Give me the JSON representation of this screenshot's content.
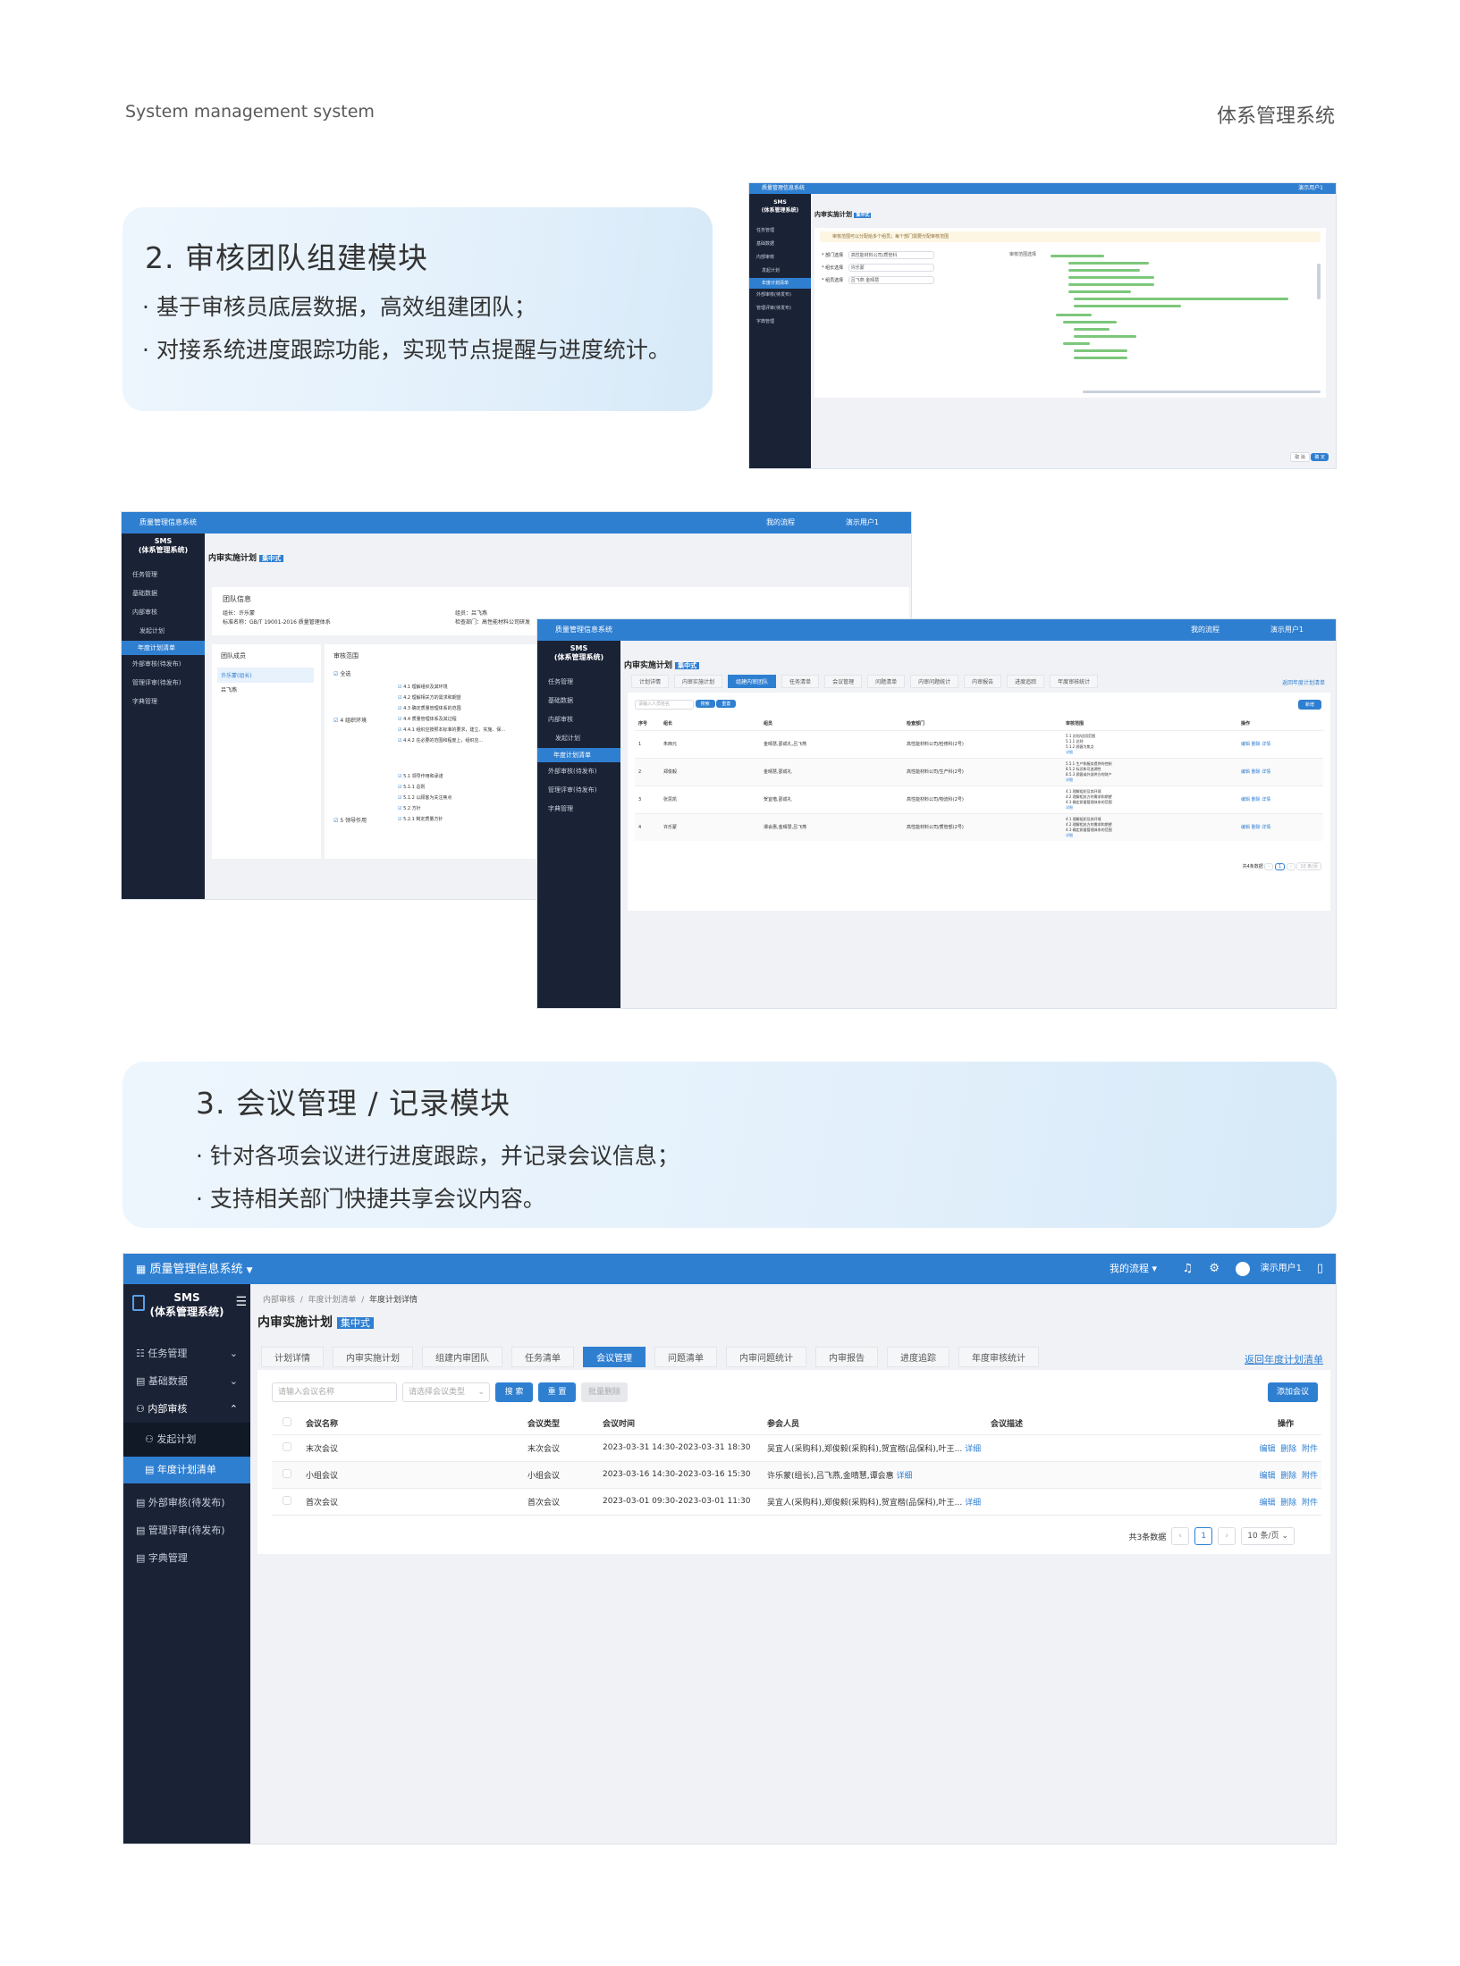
{
  "header": {
    "left": "System management system",
    "right": "体系管理系统"
  },
  "section2": {
    "title": "2. 审核团队组建模块",
    "bullets": [
      "· 基于审核员底层数据，高效组建团队；",
      "· 对接系统进度跟踪功能，实现节点提醒与进度统计。"
    ]
  },
  "section3": {
    "title": "3. 会议管理 / 记录模块",
    "bullets": [
      "· 针对各项会议进行进度跟踪，并记录会议信息；",
      "· 支持相关部门快捷共享会议内容。"
    ]
  },
  "app": {
    "system_name": "质量管理信息系统",
    "brand_line1": "SMS",
    "brand_line2": "(体系管理系统)",
    "my_process": "我的流程",
    "user": "演示用户1",
    "breadcrumb": [
      "内部审核",
      "年度计划清单",
      "年度计划详情"
    ],
    "page_title": "内审实施计划",
    "mode_badge": "集中式",
    "back_link": "返回年度计划清单",
    "side_items": [
      {
        "label": "任务管理",
        "icon": "list-icon",
        "arrow": "⌄"
      },
      {
        "label": "基础数据",
        "icon": "grid-icon",
        "arrow": "⌄"
      },
      {
        "label": "内部审核",
        "icon": "audit-icon",
        "arrow": "⌃"
      }
    ],
    "side_subs": [
      {
        "label": "发起计划",
        "icon": "plan-icon"
      },
      {
        "label": "年度计划清单",
        "icon": "doc-icon"
      }
    ],
    "side_more": [
      "外部审核(待发布)",
      "管理评审(待发布)",
      "字典管理"
    ],
    "tabs": [
      "计划详情",
      "内审实施计划",
      "组建内审团队",
      "任务清单",
      "会议管理",
      "问题清单",
      "内审问题统计",
      "内审报告",
      "进度追踪",
      "年度审核统计"
    ],
    "meeting": {
      "search_placeholder": "请输入会议名称",
      "type_placeholder": "请选择会议类型",
      "btn_search": "搜 索",
      "btn_reset": "重 置",
      "btn_batch_delete": "批量删除",
      "btn_add": "添加会议",
      "columns": [
        "会议名称",
        "会议类型",
        "会议时间",
        "参会人员",
        "会议描述",
        "操作"
      ],
      "rows": [
        {
          "name": "末次会议",
          "type": "末次会议",
          "time": "2023-03-31 14:30-2023-03-31 18:30",
          "people": "吴宜人(采购科),郑俊毅(采购科),贺宜楷(品保科),叶王...",
          "detail": "详细"
        },
        {
          "name": "小组会议",
          "type": "小组会议",
          "time": "2023-03-16 14:30-2023-03-16 15:30",
          "people": "许乐蒙(组长),吕飞燕,金晴慧,谭会惠",
          "detail": "详细"
        },
        {
          "name": "首次会议",
          "type": "首次会议",
          "time": "2023-03-01 09:30-2023-03-01 11:30",
          "people": "吴宜人(采购科),郑俊毅(采购科),贺宜楷(品保科),叶王...",
          "detail": "详细"
        }
      ],
      "ops": [
        "编辑",
        "删除",
        "附件"
      ],
      "total": "共3条数据",
      "page": "1",
      "page_size": "10 条/页"
    },
    "team": {
      "section_title": "团队信息",
      "leader_label": "组长：许乐蒙",
      "standard_label": "标准名称：GB/T 19001-2016 质量管理体系",
      "member_label": "组员：吕飞燕",
      "dept_label": "检查部门：高性能材料公司研发",
      "members_title": "团队成员",
      "scope_title": "审核范围",
      "members": [
        "许乐蒙(组长)",
        "吕飞燕"
      ],
      "scope_all": "全选",
      "scope_group1": "4 组织环境",
      "scope_group2": "5 领导作用",
      "scope_items1": [
        "4.1 理解组织及其环境",
        "4.2 理解相关方的需求和期望",
        "4.3 确定质量管理体系的范围",
        "4.4 质量管理体系及其过程",
        "4.4.1 组织应按照本标准的要求，建立、实施、保...",
        "4.4.2 在必要的范围和程度上，组织应..."
      ],
      "scope_items2": [
        "5.1 领导作用和承诺",
        "5.1.1 总则",
        "5.1.2 以顾客为关注焦点",
        "5.2 方针",
        "5.2.1 制定质量方针"
      ]
    },
    "team_list": {
      "search_placeholder": "请输入人员姓名",
      "btn_search": "搜索",
      "btn_reset": "重置",
      "btn_add": "新增",
      "columns": [
        "序号",
        "组长",
        "组员",
        "检查部门",
        "审核范围",
        "操作"
      ],
      "rows": [
        {
          "no": "1",
          "leader": "朱西元",
          "members": "金晴慧,邵成礼,吕飞燕",
          "dept": "高性能材料公司/检修科(2号)",
          "scope": [
            "5.1 总则/适用范围",
            "5.1.1 总则",
            "5.1.2 顾客为焦点",
            "详细"
          ]
        },
        {
          "no": "2",
          "leader": "郑俊毅",
          "members": "金晴慧,邵成礼",
          "dept": "高性能材料公司/生产科(2号)",
          "scope": [
            "5.5.1 生产和服务提供的控制",
            "8.5.2 标识和可追溯性",
            "8.5.3 顾客或外部供方的财产",
            "详细"
          ]
        },
        {
          "no": "3",
          "leader": "张思凯",
          "members": "贺宜楷,邵成礼",
          "dept": "高性能材料公司/物流科(2号)",
          "scope": [
            "4.1 理解组织及其环境",
            "4.2 理解相关方的需求和期望",
            "4.3 确定质量管理体系的范围",
            "详细"
          ]
        },
        {
          "no": "4",
          "leader": "许乐蒙",
          "members": "谭会惠,金晴慧,吕飞燕",
          "dept": "高性能材料公司/质管部(2号)",
          "scope": [
            "4.1 理解组织及其环境",
            "4.2 理解相关方的需求和期望",
            "4.3 确定质量管理体系的范围",
            "详细"
          ]
        }
      ],
      "ops": [
        "编辑",
        "删除",
        "详情"
      ],
      "total": "共4条数据",
      "page": "1",
      "page_size": "10 条/页"
    },
    "setup": {
      "notice": "审核范围可以分配给多个组员；每个部门需要分配审核范围",
      "field1_label": "* 部门选择",
      "field1_value": "高性能材料公司/质管科",
      "field2_label": "* 组长选择",
      "field2_value": "许乐蒙",
      "field3_label": "* 组员选择",
      "field3_value_a": "吕飞燕",
      "field3_value_b": "金晴慧",
      "scope_label": "审核范围选择",
      "btn_cancel": "取 消",
      "btn_ok": "确 定"
    }
  }
}
